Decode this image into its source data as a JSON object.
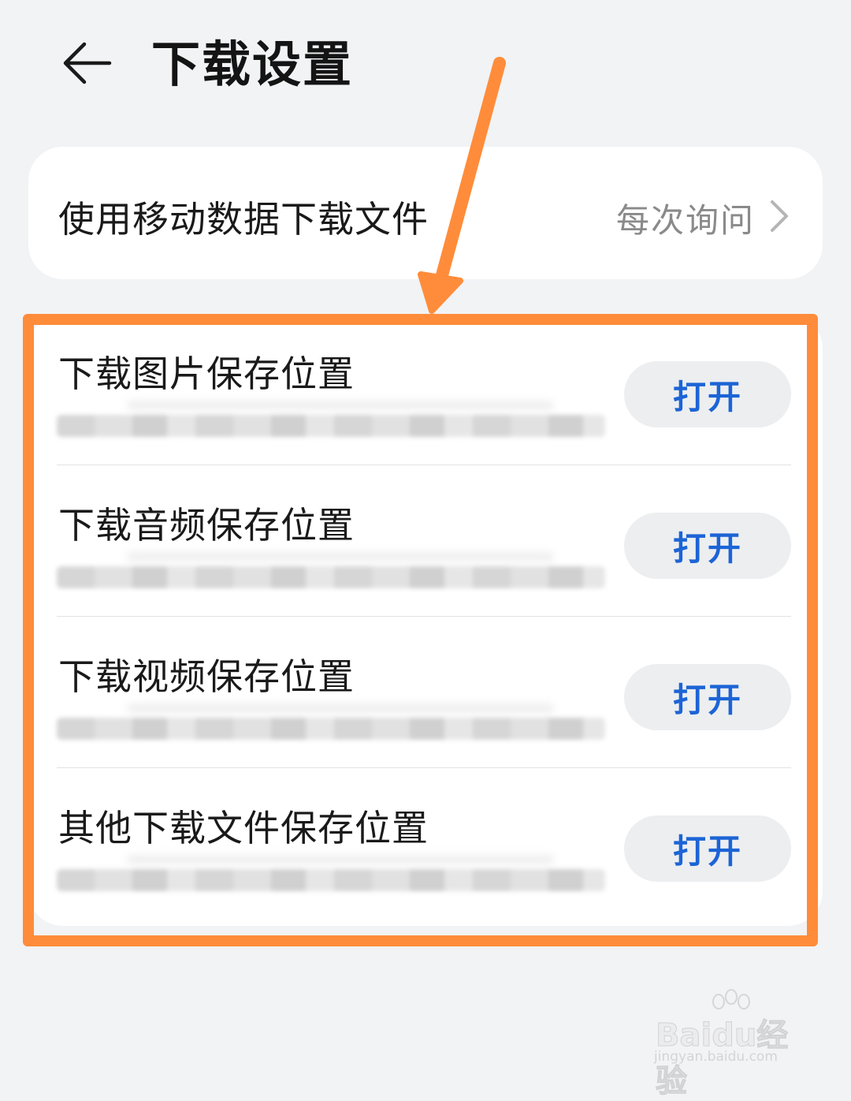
{
  "header": {
    "back_icon": "back-arrow-icon",
    "title": "下载设置"
  },
  "mobile_data": {
    "label": "使用移动数据下载文件",
    "value": "每次询问",
    "chevron_icon": "chevron-right-icon"
  },
  "locations": {
    "items": [
      {
        "label": "下载图片保存位置",
        "button": "打开"
      },
      {
        "label": "下载音频保存位置",
        "button": "打开"
      },
      {
        "label": "下载视频保存位置",
        "button": "打开"
      },
      {
        "label": "其他下载文件保存位置",
        "button": "打开"
      }
    ]
  },
  "colors": {
    "background": "#f1f3f5",
    "card": "#ffffff",
    "accent_blue": "#1c64d6",
    "annotation_orange": "#ff8c3a",
    "secondary_text": "#8a8a8a"
  },
  "watermark": {
    "text": "Baidu经验",
    "sub": "jingyan.baidu.com"
  }
}
